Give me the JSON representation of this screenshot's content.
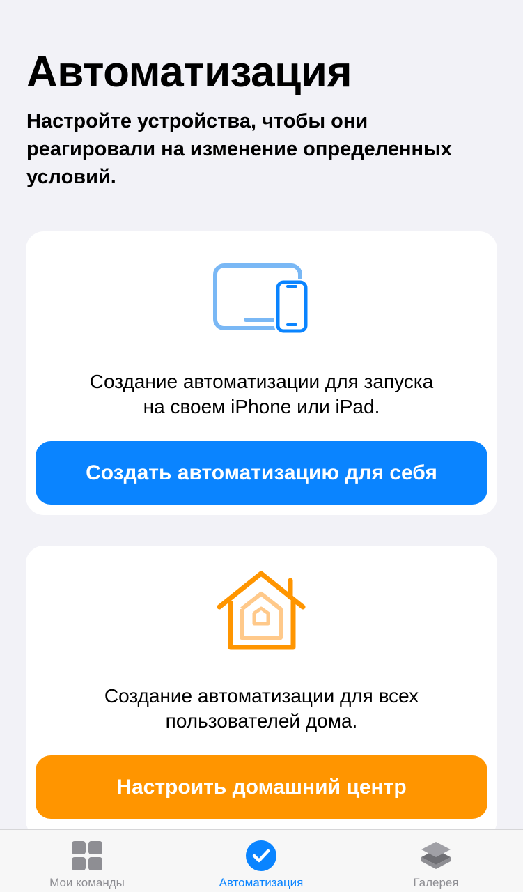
{
  "header": {
    "title": "Автоматизация",
    "subtitle": "Настройте устройства, чтобы они реагировали на изменение определенных условий."
  },
  "cards": [
    {
      "icon": "devices-icon",
      "text": "Создание автоматизации для запуска\nна своем iPhone или iPad.",
      "button_label": "Создать автоматизацию для себя",
      "button_color": "#0a84ff"
    },
    {
      "icon": "home-icon",
      "text": "Создание автоматизации для всех\nпользователей дома.",
      "button_label": "Настроить домашний центр",
      "button_color": "#ff9500"
    }
  ],
  "tabbar": {
    "active_color": "#0a84ff",
    "inactive_color": "#8e8e93",
    "tabs": [
      {
        "label": "Мои команды",
        "icon": "grid-icon",
        "active": false
      },
      {
        "label": "Автоматизация",
        "icon": "checkmark-circle-icon",
        "active": true
      },
      {
        "label": "Галерея",
        "icon": "layers-icon",
        "active": false
      }
    ]
  }
}
